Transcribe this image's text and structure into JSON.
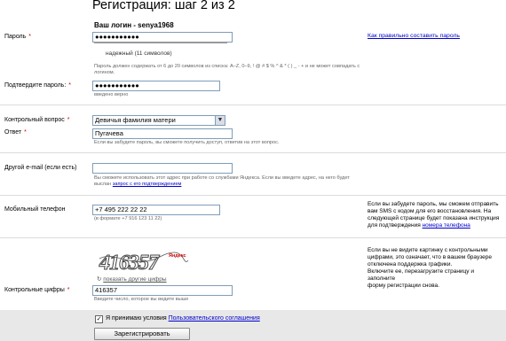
{
  "page": {
    "title": "Регистрация: шаг 2 из 2",
    "login_line": "Ваш логин - senya1968"
  },
  "password": {
    "label": "Пароль",
    "required": "*",
    "value": "●●●●●●●●●●●",
    "strength_text": "надежный (11 символов)",
    "strength_level": 1.0,
    "help_link": "Как правильно составить пароль",
    "rules_line1": "Пароль должен содержать от 6 до 20 символов из списка: A–Z, 0–9, ! @ # $ % ^ & * ( ) _ - + и не может совпадать с",
    "rules_line2": "логином."
  },
  "password_confirm": {
    "label": "Подтвердите пароль:",
    "required": "*",
    "value": "●●●●●●●●●●●",
    "hint": "введено верно"
  },
  "security": {
    "question_label": "Контрольный вопрос",
    "question_required": "*",
    "question_value": "Девичья фамилия матери",
    "answer_label": "Ответ",
    "answer_required": "*",
    "answer_value": "Пугачева",
    "answer_hint": "Если вы забудете пароль, вы сможете получить доступ, ответив на этот вопрос."
  },
  "other_email": {
    "label": "Другой e-mail (если есть)",
    "value": "",
    "hint_line1": "Вы сможете использовать этот адрес при работе со службами Яндекса. Если вы введете адрес, на него будет",
    "hint_line2_prefix": "выслан ",
    "hint_line2_link": "запрос с его подтверждением"
  },
  "phone": {
    "label": "Мобильный телефон",
    "value": "+7 495 222 22 22",
    "hint": "(в формате +7 916 123 11 22)",
    "side_text_1": "Если вы забудете пароль, мы сможем отправить",
    "side_text_2": "вам SMS с кодом для его восстановления. На",
    "side_text_3": "следующей странице будет показана инструкция",
    "side_text_4_prefix": "для подтверждения ",
    "side_text_4_link": "номера телефона"
  },
  "captcha": {
    "image_text": "416357",
    "brand_text": "Яндекс",
    "refresh_link": "показать другие цифры",
    "label": "Контрольные цифры",
    "required": "*",
    "value": "416357",
    "hint": "Введите число, которое вы видите выше",
    "side_text_1": "Если вы не видите картинку с контрольными",
    "side_text_2": "цифрами, это означает, что в вашем браузере",
    "side_text_3": "отключена поддержка графики.",
    "side_text_4": "Включите ее, перезагрузите страницу и заполните",
    "side_text_5": "форму регистрации снова."
  },
  "agreement": {
    "checkbox_mark": "✓",
    "text_prefix": "Я принимаю условия ",
    "link": "Пользовательского соглашения"
  },
  "submit": {
    "label": "Зарегистрировать"
  },
  "colors": {
    "link": "#0000cc",
    "required": "#cc0000",
    "bottom_bar": "#e8e8e8"
  }
}
